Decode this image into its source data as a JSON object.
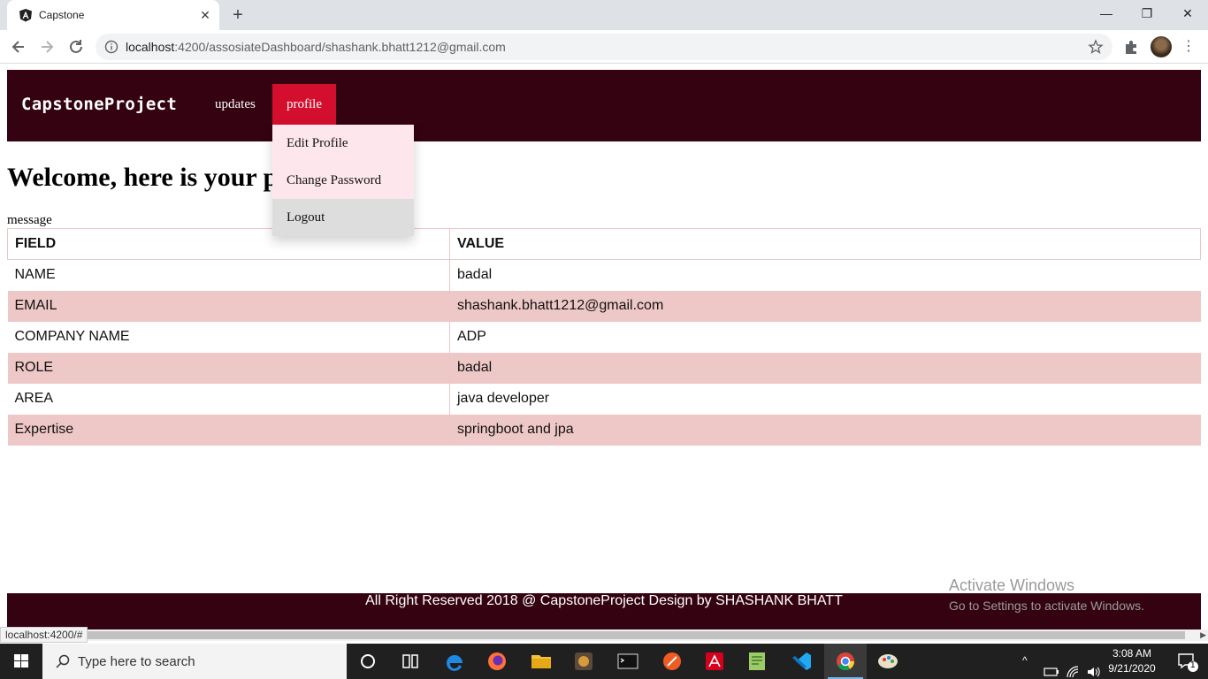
{
  "browser": {
    "tab_title": "Capstone",
    "url_host": "localhost",
    "url_rest": ":4200/assosiateDashboard/shashank.bhatt1212@gmail.com",
    "status_url": "localhost:4200/#"
  },
  "navbar": {
    "brand": "CapstoneProject",
    "links": [
      {
        "label": "updates"
      },
      {
        "label": "profile"
      }
    ],
    "dropdown": [
      {
        "label": "Edit Profile"
      },
      {
        "label": "Change Password"
      },
      {
        "label": "Logout"
      }
    ]
  },
  "main": {
    "heading": "Welcome, here is your profile",
    "message": "message",
    "table": {
      "headers": [
        "FIELD",
        "VALUE"
      ],
      "rows": [
        [
          "NAME",
          "badal"
        ],
        [
          "EMAIL",
          "shashank.bhatt1212@gmail.com"
        ],
        [
          "COMPANY NAME",
          "ADP"
        ],
        [
          "ROLE",
          "badal"
        ],
        [
          "AREA",
          "java developer"
        ],
        [
          "Expertise",
          "springboot and jpa"
        ]
      ]
    }
  },
  "footer": {
    "text": "All Right Reserved 2018 @ CapstoneProject Design by SHASHANK BHATT"
  },
  "watermark": {
    "title": "Activate Windows",
    "subtitle": "Go to Settings to activate Windows."
  },
  "taskbar": {
    "search_placeholder": "Type here to search",
    "time": "3:08 AM",
    "date": "9/21/2020",
    "notification_count": "1"
  },
  "colors": {
    "navbar_bg": "#340210",
    "active_link": "#d30f2d",
    "dropdown_bg": "#fde7ec",
    "row_stripe": "#eec8c7"
  }
}
